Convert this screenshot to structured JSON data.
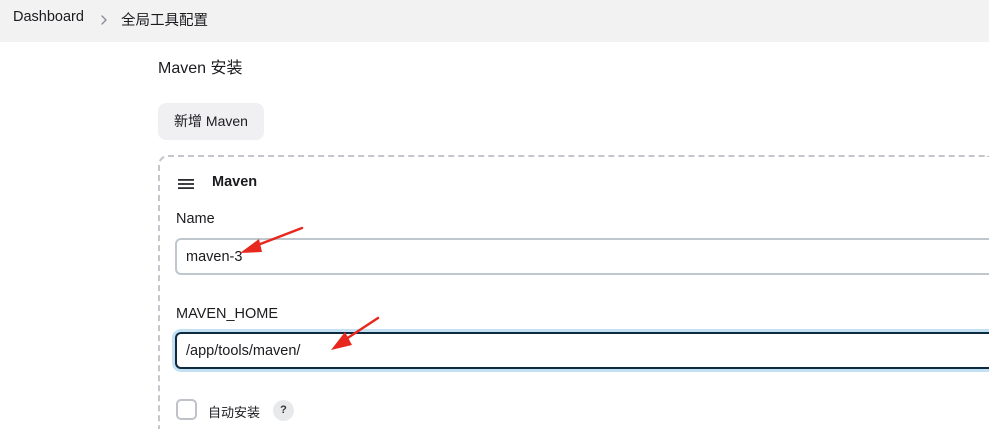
{
  "breadcrumb": {
    "items": [
      "Dashboard",
      "全局工具配置"
    ],
    "separator_icon": "chevron-right-icon"
  },
  "section": {
    "title": "Maven 安装",
    "add_button_label": "新增 Maven"
  },
  "installation": {
    "handle_icon": "drag-handle-icon",
    "title": "Maven",
    "name_label": "Name",
    "name_value": "maven-3",
    "home_label": "MAVEN_HOME",
    "home_value": "/app/tools/maven/",
    "auto_install_label": "自动安装",
    "auto_install_checked": false,
    "help_text": "?"
  },
  "colors": {
    "breadcrumb_bg": "#f2f2f3",
    "focus_border": "#0e2a3e",
    "annotation_arrow": "#e8281f"
  }
}
